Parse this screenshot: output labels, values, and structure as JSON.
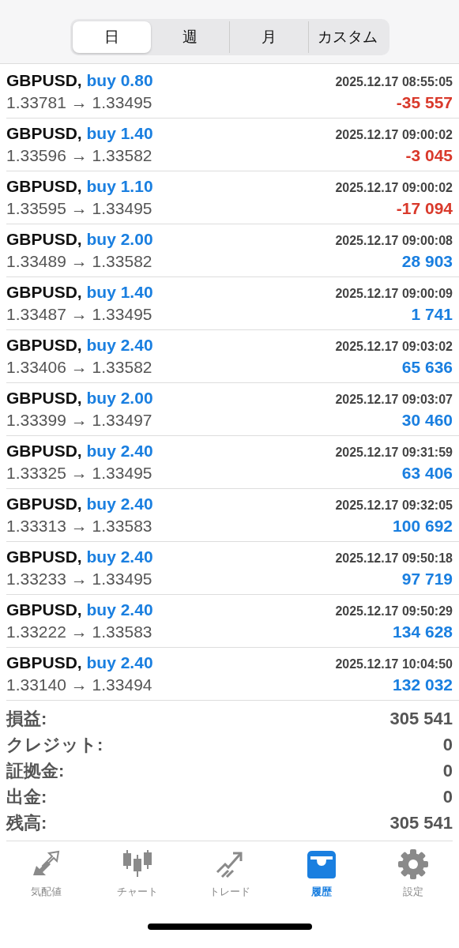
{
  "period_tabs": [
    {
      "label": "日",
      "selected": true
    },
    {
      "label": "週",
      "selected": false
    },
    {
      "label": "月",
      "selected": false
    },
    {
      "label": "カスタム",
      "selected": false
    }
  ],
  "deals": [
    {
      "symbol": "GBPUSD,",
      "side": "buy 0.80",
      "time": "2025.12.17 08:55:05",
      "prices": "1.33781 → 1.33495",
      "profit": "-35 557",
      "color": "#d9392b"
    },
    {
      "symbol": "GBPUSD,",
      "side": "buy 1.40",
      "time": "2025.12.17 09:00:02",
      "prices": "1.33596 → 1.33582",
      "profit": "-3 045",
      "color": "#d9392b"
    },
    {
      "symbol": "GBPUSD,",
      "side": "buy 1.10",
      "time": "2025.12.17 09:00:02",
      "prices": "1.33595 → 1.33495",
      "profit": "-17 094",
      "color": "#d9392b"
    },
    {
      "symbol": "GBPUSD,",
      "side": "buy 2.00",
      "time": "2025.12.17 09:00:08",
      "prices": "1.33489 → 1.33582",
      "profit": "28 903",
      "color": "#1a7fe0"
    },
    {
      "symbol": "GBPUSD,",
      "side": "buy 1.40",
      "time": "2025.12.17 09:00:09",
      "prices": "1.33487 → 1.33495",
      "profit": "1 741",
      "color": "#1a7fe0"
    },
    {
      "symbol": "GBPUSD,",
      "side": "buy 2.40",
      "time": "2025.12.17 09:03:02",
      "prices": "1.33406 → 1.33582",
      "profit": "65 636",
      "color": "#1a7fe0"
    },
    {
      "symbol": "GBPUSD,",
      "side": "buy 2.00",
      "time": "2025.12.17 09:03:07",
      "prices": "1.33399 → 1.33497",
      "profit": "30 460",
      "color": "#1a7fe0"
    },
    {
      "symbol": "GBPUSD,",
      "side": "buy 2.40",
      "time": "2025.12.17 09:31:59",
      "prices": "1.33325 → 1.33495",
      "profit": "63 406",
      "color": "#1a7fe0"
    },
    {
      "symbol": "GBPUSD,",
      "side": "buy 2.40",
      "time": "2025.12.17 09:32:05",
      "prices": "1.33313 → 1.33583",
      "profit": "100 692",
      "color": "#1a7fe0"
    },
    {
      "symbol": "GBPUSD,",
      "side": "buy 2.40",
      "time": "2025.12.17 09:50:18",
      "prices": "1.33233 → 1.33495",
      "profit": "97 719",
      "color": "#1a7fe0"
    },
    {
      "symbol": "GBPUSD,",
      "side": "buy 2.40",
      "time": "2025.12.17 09:50:29",
      "prices": "1.33222 → 1.33583",
      "profit": "134 628",
      "color": "#1a7fe0"
    },
    {
      "symbol": "GBPUSD,",
      "side": "buy 2.40",
      "time": "2025.12.17 10:04:50",
      "prices": "1.33140 → 1.33494",
      "profit": "132 032",
      "color": "#1a7fe0"
    }
  ],
  "summary": [
    {
      "label": "損益:",
      "value": "305 541"
    },
    {
      "label": "クレジット:",
      "value": "0"
    },
    {
      "label": "証拠金:",
      "value": "0"
    },
    {
      "label": "出金:",
      "value": "0"
    },
    {
      "label": "残高:",
      "value": "305 541"
    }
  ],
  "tab_bar": [
    {
      "kind": "quotes",
      "label": "気配値",
      "selected": false
    },
    {
      "kind": "chart",
      "label": "チャート",
      "selected": false
    },
    {
      "kind": "trade",
      "label": "トレード",
      "selected": false
    },
    {
      "kind": "history",
      "label": "履歴",
      "selected": true
    },
    {
      "kind": "settings",
      "label": "設定",
      "selected": false
    }
  ]
}
